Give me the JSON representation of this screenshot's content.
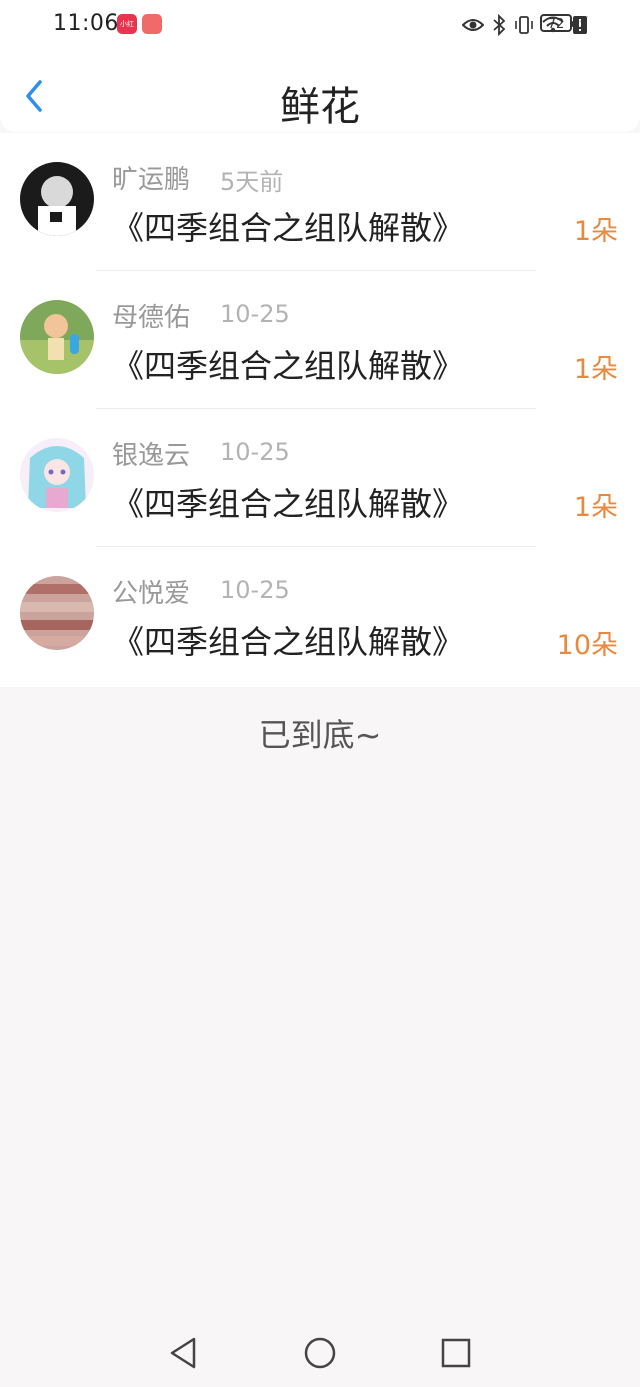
{
  "status_bar": {
    "time": "11:06",
    "badge1_text": "小红书",
    "badge1_color": "#e8344e",
    "badge2_color": "#f06a6a",
    "battery": "72",
    "icons": [
      "eye-icon",
      "bluetooth-icon",
      "vibrate-icon",
      "wifi-icon",
      "alert-icon",
      "battery-icon",
      "charging-icon"
    ]
  },
  "header": {
    "title": "鲜花",
    "back_icon": "chevron-left-icon",
    "accent_color": "#2e8ee8"
  },
  "items": [
    {
      "name": "旷运鹏",
      "time": "5天前",
      "book": "《四季组合之组队解散》",
      "flowers": "1朵",
      "avatar_color": "#1b1b1b"
    },
    {
      "name": "母德佑",
      "time": "10-25",
      "book": "《四季组合之组队解散》",
      "flowers": "1朵",
      "avatar_color": "#6a9a4a"
    },
    {
      "name": "银逸云",
      "time": "10-25",
      "book": "《四季组合之组队解散》",
      "flowers": "1朵",
      "avatar_color": "#e9d6f0"
    },
    {
      "name": "公悦爱",
      "time": "10-25",
      "book": "《四季组合之组队解散》",
      "flowers": "10朵",
      "avatar_color": "#b98a84"
    }
  ],
  "footer": {
    "end_text": "已到底~"
  },
  "nav": {
    "back_icon": "triangle-back-icon",
    "home_icon": "circle-home-icon",
    "recents_icon": "square-recents-icon"
  }
}
